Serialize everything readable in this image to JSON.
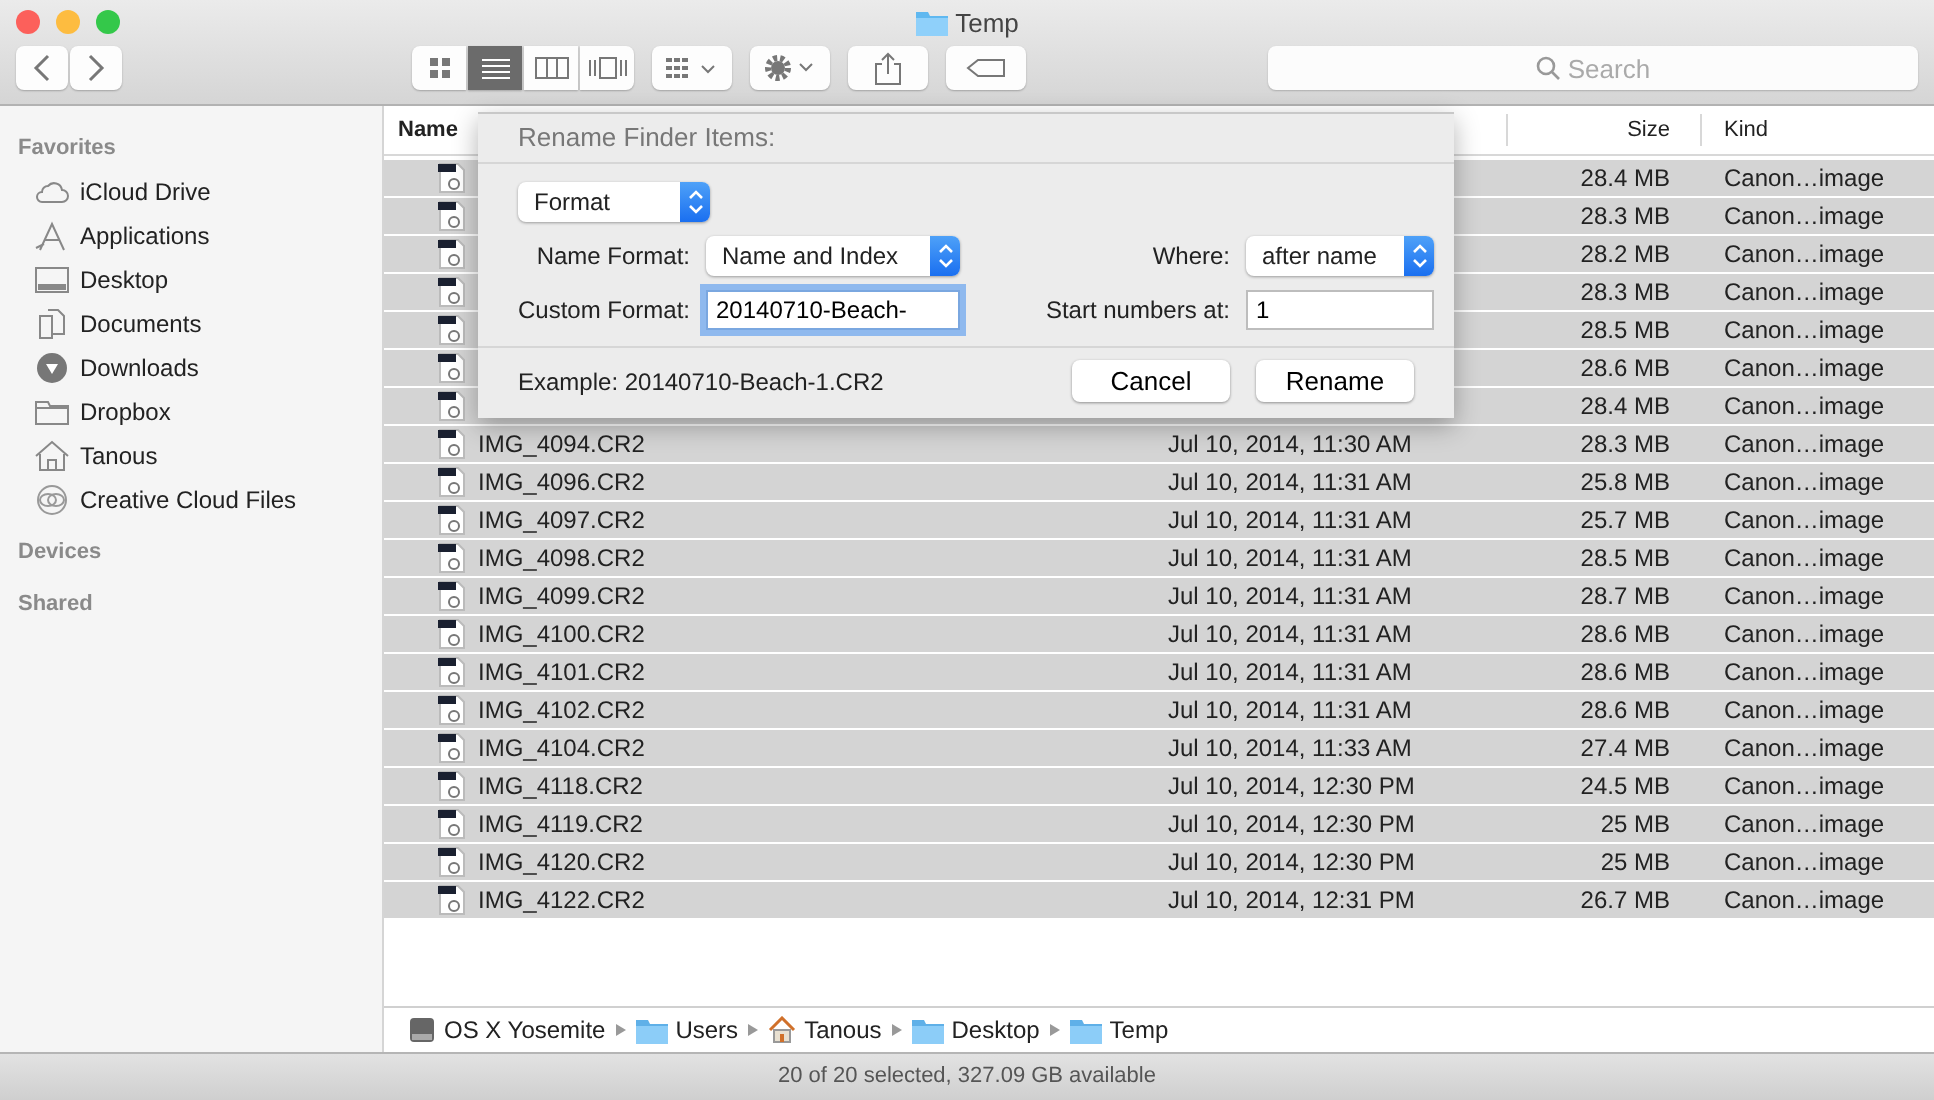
{
  "window": {
    "title": "Temp"
  },
  "toolbar": {
    "view_modes": [
      {
        "selected": false
      },
      {
        "selected": true
      },
      {
        "selected": false
      },
      {
        "selected": false
      }
    ],
    "search": {
      "placeholder": "Search"
    }
  },
  "sidebar": {
    "sections": [
      {
        "title": "Favorites",
        "items": [
          {
            "label": "iCloud Drive"
          },
          {
            "label": "Applications"
          },
          {
            "label": "Desktop"
          },
          {
            "label": "Documents"
          },
          {
            "label": "Downloads"
          },
          {
            "label": "Dropbox"
          },
          {
            "label": "Tanous"
          },
          {
            "label": "Creative Cloud Files"
          }
        ]
      },
      {
        "title": "Devices"
      },
      {
        "title": "Shared"
      }
    ]
  },
  "table": {
    "columns": [
      "Name",
      "Size",
      "Kind"
    ],
    "rows": [
      {
        "size": "28.4 MB",
        "kind": "Canon…image",
        "selected": true
      },
      {
        "size": "28.3 MB",
        "kind": "Canon…image",
        "selected": true
      },
      {
        "size": "28.2 MB",
        "kind": "Canon…image",
        "selected": true
      },
      {
        "size": "28.3 MB",
        "kind": "Canon…image",
        "selected": true
      },
      {
        "size": "28.5 MB",
        "kind": "Canon…image",
        "selected": true
      },
      {
        "size": "28.6 MB",
        "kind": "Canon…image",
        "selected": true
      },
      {
        "size": "28.4 MB",
        "kind": "Canon…image",
        "selected": true
      },
      {
        "name": "IMG_4094.CR2",
        "date": "Jul 10, 2014, 11:30 AM",
        "size": "28.3 MB",
        "kind": "Canon…image",
        "selected": true
      },
      {
        "name": "IMG_4096.CR2",
        "date": "Jul 10, 2014, 11:31 AM",
        "size": "25.8 MB",
        "kind": "Canon…image",
        "selected": true
      },
      {
        "name": "IMG_4097.CR2",
        "date": "Jul 10, 2014, 11:31 AM",
        "size": "25.7 MB",
        "kind": "Canon…image",
        "selected": true
      },
      {
        "name": "IMG_4098.CR2",
        "date": "Jul 10, 2014, 11:31 AM",
        "size": "28.5 MB",
        "kind": "Canon…image",
        "selected": true
      },
      {
        "name": "IMG_4099.CR2",
        "date": "Jul 10, 2014, 11:31 AM",
        "size": "28.7 MB",
        "kind": "Canon…image",
        "selected": true
      },
      {
        "name": "IMG_4100.CR2",
        "date": "Jul 10, 2014, 11:31 AM",
        "size": "28.6 MB",
        "kind": "Canon…image",
        "selected": true
      },
      {
        "name": "IMG_4101.CR2",
        "date": "Jul 10, 2014, 11:31 AM",
        "size": "28.6 MB",
        "kind": "Canon…image",
        "selected": true
      },
      {
        "name": "IMG_4102.CR2",
        "date": "Jul 10, 2014, 11:31 AM",
        "size": "28.6 MB",
        "kind": "Canon…image",
        "selected": true
      },
      {
        "name": "IMG_4104.CR2",
        "date": "Jul 10, 2014, 11:33 AM",
        "size": "27.4 MB",
        "kind": "Canon…image",
        "selected": true
      },
      {
        "name": "IMG_4118.CR2",
        "date": "Jul 10, 2014, 12:30 PM",
        "size": "24.5 MB",
        "kind": "Canon…image",
        "selected": true
      },
      {
        "name": "IMG_4119.CR2",
        "date": "Jul 10, 2014, 12:30 PM",
        "size": "25 MB",
        "kind": "Canon…image",
        "selected": true
      },
      {
        "name": "IMG_4120.CR2",
        "date": "Jul 10, 2014, 12:30 PM",
        "size": "25 MB",
        "kind": "Canon…image",
        "selected": true
      },
      {
        "name": "IMG_4122.CR2",
        "date": "Jul 10, 2014, 12:31 PM",
        "size": "26.7 MB",
        "kind": "Canon…image",
        "selected": true
      }
    ]
  },
  "sheet": {
    "title": "Rename Finder Items:",
    "mode": "Format",
    "name_format_label": "Name Format:",
    "name_format": "Name and Index",
    "where_label": "Where:",
    "where": "after name",
    "custom_format_label": "Custom Format:",
    "custom_format": "20140710-Beach-",
    "start_label": "Start numbers at:",
    "start": "1",
    "example": "Example: 20140710-Beach-1.CR2",
    "buttons": [
      "Cancel",
      "Rename"
    ]
  },
  "path_bar": [
    "OS X Yosemite",
    "Users",
    "Tanous",
    "Desktop",
    "Temp"
  ],
  "status_bar": "20 of 20 selected, 327.09 GB available"
}
